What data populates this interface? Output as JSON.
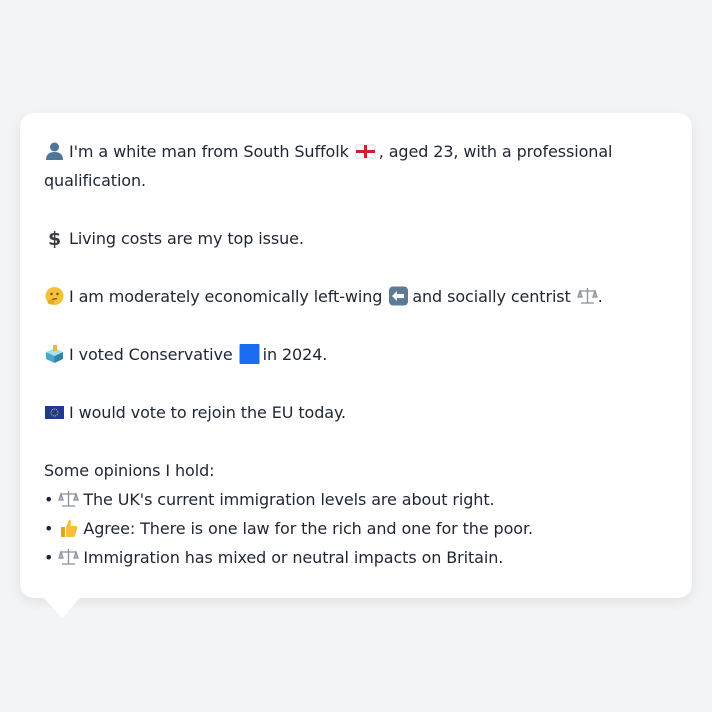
{
  "persona": {
    "identity": {
      "icon": "person-silhouette-icon",
      "text_before_flag": "I'm a white man from South Suffolk",
      "flag_icon": "england-flag-icon",
      "text_after_flag": ", aged 23, with a professional",
      "text_line2": "qualification."
    },
    "top_issue": {
      "icon": "dollar-sign-icon",
      "text": "Living costs are my top issue."
    },
    "ideology": {
      "icon": "thinking-face-icon",
      "text_part1": "I am moderately economically left-wing",
      "left_icon": "left-arrow-icon",
      "text_part2": "and socially centrist",
      "centrist_icon": "balance-scale-icon",
      "text_end": "."
    },
    "vote": {
      "icon": "ballot-box-icon",
      "text_part1": "I voted Conservative",
      "party_icon": "blue-square-icon",
      "party_color": "#1a6cf0",
      "text_part2": "in 2024."
    },
    "eu": {
      "icon": "eu-flag-icon",
      "text": "I would vote to rejoin the EU today."
    },
    "opinions_heading": "Some opinions I hold:",
    "opinions": [
      {
        "bullet": "•",
        "icon": "balance-scale-icon",
        "text": "The UK's current immigration levels are about right."
      },
      {
        "bullet": "•",
        "icon": "thumbs-up-icon",
        "text": "Agree: There is one law for the rich and one for the poor."
      },
      {
        "bullet": "•",
        "icon": "balance-scale-icon",
        "text": "Immigration has mixed or neutral impacts on Britain."
      }
    ]
  }
}
